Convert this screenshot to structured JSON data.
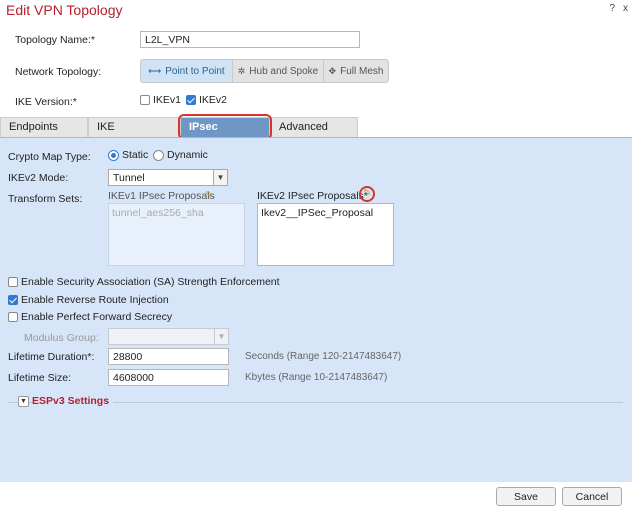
{
  "dialog": {
    "title": "Edit VPN Topology",
    "help_icon": "?",
    "close_icon": "x"
  },
  "topology": {
    "name_label": "Topology Name:*",
    "name_value": "L2L_VPN",
    "network_label": "Network Topology:",
    "options": [
      {
        "label": "Point to Point",
        "icon": "arrows-icon",
        "glyph": "⟷"
      },
      {
        "label": "Hub and Spoke",
        "icon": "hub-icon",
        "glyph": "✲"
      },
      {
        "label": "Full Mesh",
        "icon": "mesh-icon",
        "glyph": "✥"
      }
    ],
    "selected": "Point to Point",
    "ike_version_label": "IKE Version:*",
    "ikev1_label": "IKEv1",
    "ikev1_checked": false,
    "ikev2_label": "IKEv2",
    "ikev2_checked": true
  },
  "tabs": [
    {
      "label": "Endpoints",
      "active": false
    },
    {
      "label": "IKE",
      "active": false
    },
    {
      "label": "IPsec",
      "active": true
    },
    {
      "label": "Advanced",
      "active": false
    }
  ],
  "ipsec": {
    "crypto_map_label": "Crypto Map Type:",
    "crypto_static": "Static",
    "crypto_dynamic": "Dynamic",
    "crypto_selected": "Static",
    "ikev2_mode_label": "IKEv2 Mode:",
    "ikev2_mode_value": "Tunnel",
    "transform_sets_label": "Transform Sets:",
    "ikev1_proposals_label": "IKEv1 IPsec Proposals",
    "ikev1_proposals": [
      "tunnel_aes256_sha"
    ],
    "ikev2_proposals_label": "IKEv2 IPsec Proposals*",
    "ikev2_proposals": [
      "Ikev2__IPSec_Proposal"
    ],
    "sa_strength_label": "Enable Security Association (SA) Strength Enforcement",
    "sa_strength_checked": false,
    "rri_label": "Enable Reverse Route Injection",
    "rri_checked": true,
    "pfs_label": "Enable Perfect Forward Secrecy",
    "pfs_checked": false,
    "modulus_label": "Modulus Group:",
    "modulus_value": "",
    "lifetime_duration_label": "Lifetime Duration*:",
    "lifetime_duration_value": "28800",
    "lifetime_duration_hint": "Seconds (Range 120-2147483647)",
    "lifetime_size_label": "Lifetime Size:",
    "lifetime_size_value": "4608000",
    "lifetime_size_hint": "Kbytes (Range 10-2147483647)",
    "espv3_label": "ESPv3 Settings"
  },
  "footer": {
    "save_label": "Save",
    "cancel_label": "Cancel"
  },
  "colors": {
    "title": "#b5202e",
    "panel": "#d6e6f8",
    "active_tab": "#6f97c6",
    "highlight": "#d9342b",
    "checkbox": "#2f7bd1"
  }
}
